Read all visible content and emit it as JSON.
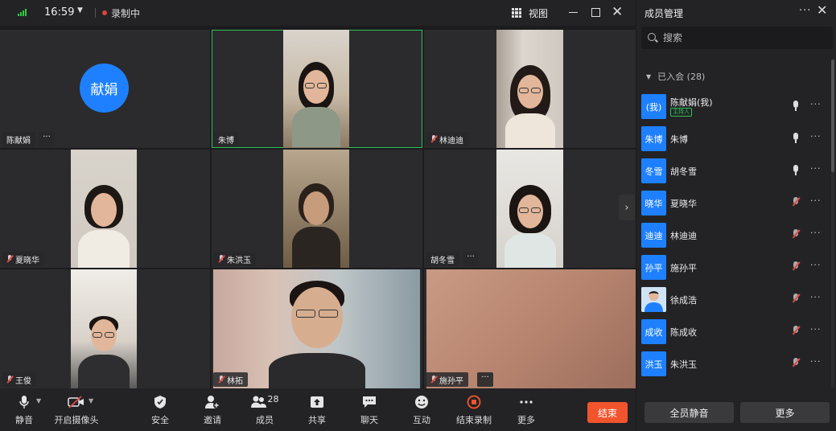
{
  "topbar": {
    "time": "16:59",
    "recording_label": "录制中",
    "view_label": "视图"
  },
  "tiles": [
    {
      "name": "陈献娟",
      "avatar": "献娟"
    },
    {
      "name": "朱博"
    },
    {
      "name": "林迪迪"
    },
    {
      "name": "夏晓华"
    },
    {
      "name": "朱洪玉"
    },
    {
      "name": "胡冬雪"
    },
    {
      "name": "王俊"
    },
    {
      "name": "林拓"
    },
    {
      "name": "施孙平"
    }
  ],
  "toolbar": {
    "mute": "静音",
    "camera": "开启摄像头",
    "security": "安全",
    "invite": "邀请",
    "members": "成员",
    "members_count": "28",
    "share": "共享",
    "chat": "聊天",
    "interact": "互动",
    "stop_record": "结束录制",
    "more": "更多",
    "end": "结束"
  },
  "panel": {
    "title": "成员管理",
    "search_placeholder": "搜索",
    "group_label": "已入会 (28)",
    "members": [
      {
        "avatar": "(我)",
        "name": "陈献娟(我)",
        "badge": "主持人",
        "mic": "on"
      },
      {
        "avatar": "朱博",
        "name": "朱博",
        "mic": "on"
      },
      {
        "avatar": "冬雪",
        "name": "胡冬雪",
        "mic": "on"
      },
      {
        "avatar": "晓华",
        "name": "夏晓华",
        "mic": "muted"
      },
      {
        "avatar": "迪迪",
        "name": "林迪迪",
        "mic": "muted"
      },
      {
        "avatar": "孙平",
        "name": "施孙平",
        "mic": "muted"
      },
      {
        "avatar": "",
        "name": "徐成浩",
        "mic": "muted",
        "photo": true
      },
      {
        "avatar": "成收",
        "name": "陈成收",
        "mic": "muted"
      },
      {
        "avatar": "洪玉",
        "name": "朱洪玉",
        "mic": "muted"
      }
    ],
    "mute_all": "全员静音",
    "more": "更多"
  },
  "colors": {
    "accent": "#1e80ff",
    "active_border": "#2ec05a",
    "end_button": "#f2542d",
    "record_dot": "#d9463b"
  }
}
